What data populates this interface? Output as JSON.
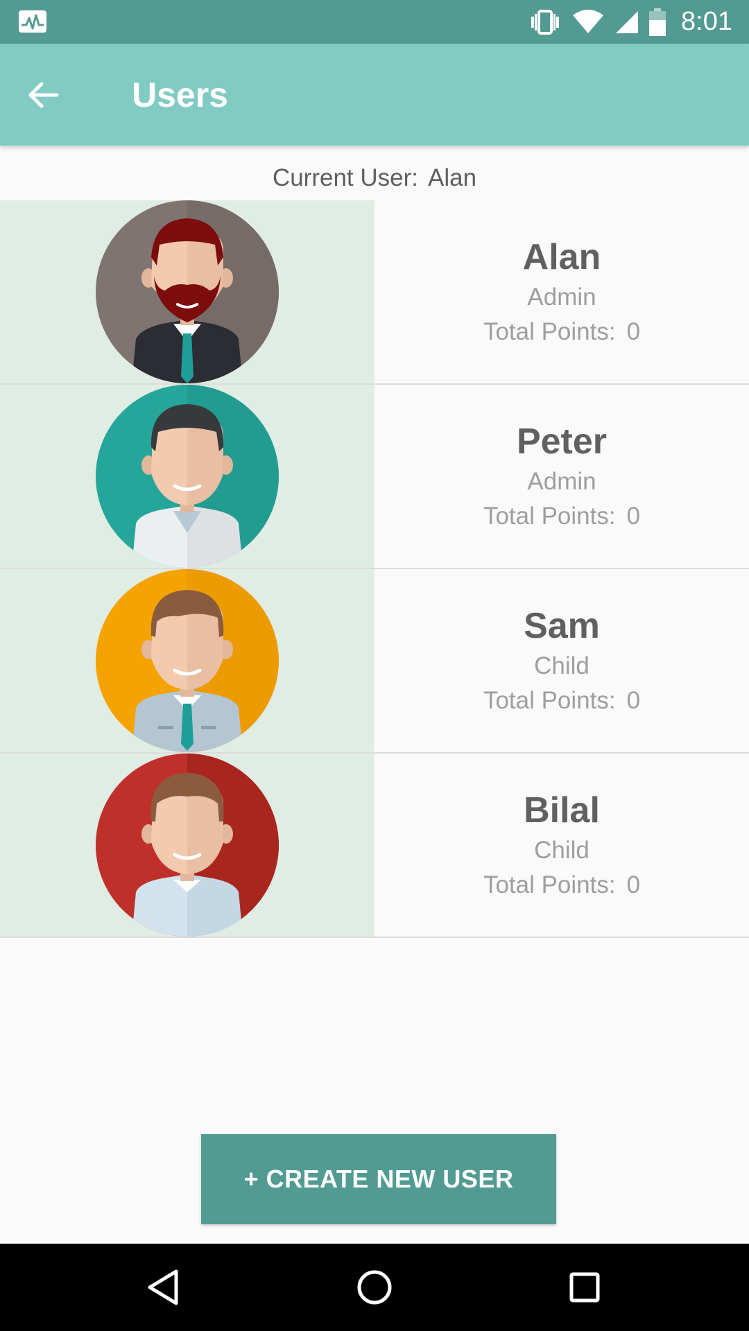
{
  "status_bar": {
    "time": "8:01",
    "icons": [
      "activity-monitor-icon",
      "vibrate-icon",
      "wifi-icon",
      "cell-signal-icon",
      "battery-icon"
    ],
    "background": "#539a92"
  },
  "app_bar": {
    "title": "Users",
    "back_icon": "arrow-left-icon",
    "background": "#81cbc3"
  },
  "current_user": {
    "label": "Current User:",
    "name": "Alan"
  },
  "users": [
    {
      "name": "Alan",
      "role": "Admin",
      "points_label": "Total Points:",
      "points": "0",
      "avatar": "bearded-man-avatar-icon",
      "avatar_bg": "#7f7471"
    },
    {
      "name": "Peter",
      "role": "Admin",
      "points_label": "Total Points:",
      "points": "0",
      "avatar": "dark-hair-man-avatar-icon",
      "avatar_bg": "#26a69a"
    },
    {
      "name": "Sam",
      "role": "Child",
      "points_label": "Total Points:",
      "points": "0",
      "avatar": "boy-with-tie-avatar-icon",
      "avatar_bg": "#f5a300"
    },
    {
      "name": "Bilal",
      "role": "Child",
      "points_label": "Total Points:",
      "points": "0",
      "avatar": "brown-hair-man-avatar-icon",
      "avatar_bg": "#c0302b"
    }
  ],
  "create_button": {
    "label": "+ CREATE NEW USER",
    "background": "#529b92"
  },
  "nav_bar": {
    "buttons": [
      "back-triangle-icon",
      "home-circle-icon",
      "recents-square-icon"
    ]
  },
  "colors": {
    "avatar_cell_bg": "#e0ede4",
    "name_text": "#606060",
    "secondary_text": "#9e9e9e"
  }
}
